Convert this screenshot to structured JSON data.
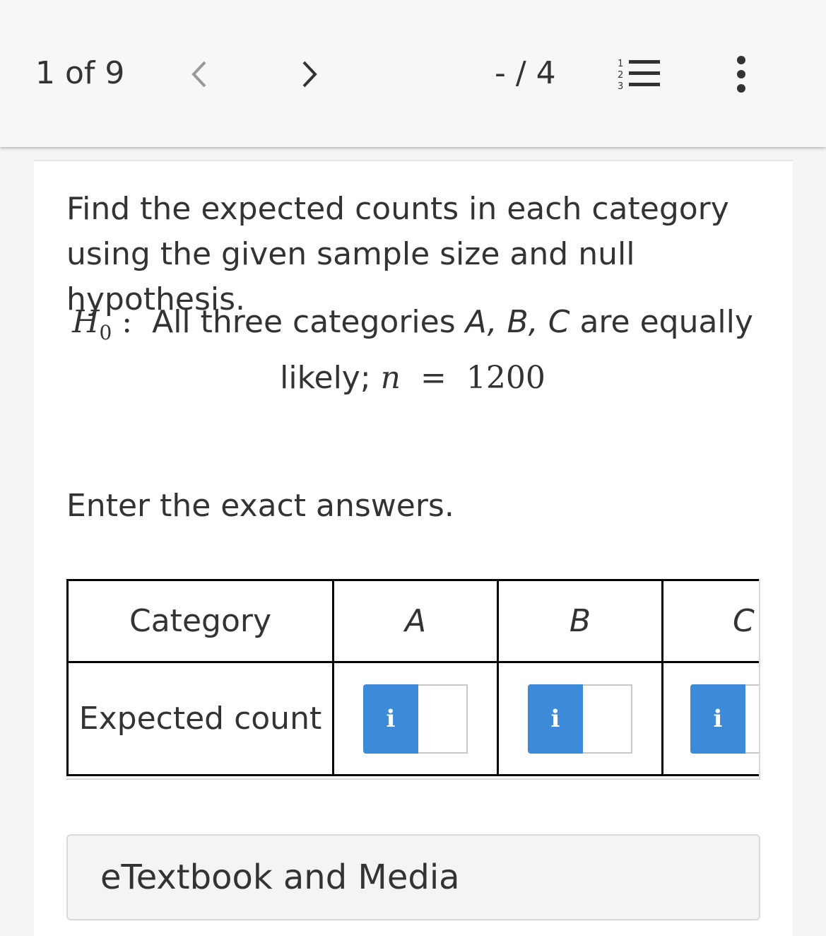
{
  "topbar": {
    "counter": "1 of 9",
    "score": "- / 4",
    "prev_icon": "chevron-left-icon",
    "next_icon": "chevron-right-icon",
    "list_icon": "numbered-list-icon",
    "more_icon": "more-vertical-icon"
  },
  "question": {
    "line1": "Find the expected counts in each category",
    "line2": "using the given sample size and null hypothesis.",
    "h0_symbol": "H",
    "h0_sub": "0",
    "h0_colon": ":",
    "h0_text": "All three categories",
    "h0_cats": "A, B, C",
    "h0_text2": "are equally",
    "line_likely": "likely;",
    "n_var": "n",
    "n_eq": "=",
    "n_value": "1200",
    "instruction": "Enter the exact answers."
  },
  "table": {
    "header_label": "Category",
    "categories": [
      "A",
      "B",
      "C"
    ],
    "row_label": "Expected count",
    "info_label": "i",
    "values": [
      "",
      "",
      ""
    ]
  },
  "etextbook": {
    "label": "eTextbook and Media"
  }
}
